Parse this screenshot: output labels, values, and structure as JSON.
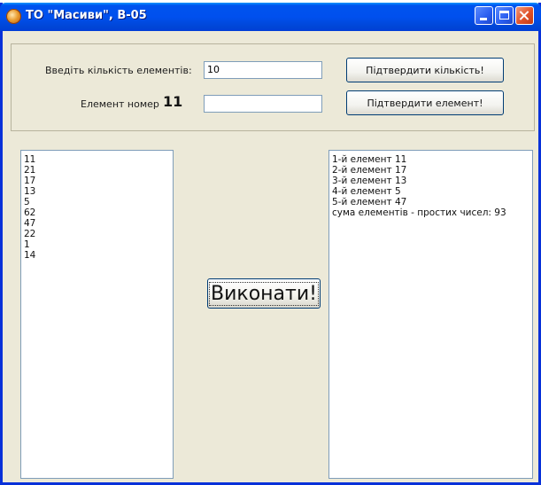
{
  "window": {
    "title": "ТО \"Масиви\", В-05"
  },
  "controls": {
    "count_label": "Введіть кількість елементів:",
    "count_value": "10",
    "confirm_count_label": "Підтвердити кількість!",
    "element_label": "Елемент номер",
    "element_number": "11",
    "element_value": "",
    "confirm_element_label": "Підтвердити елемент!"
  },
  "input_list": {
    "items": [
      "11",
      "21",
      "17",
      "13",
      "5",
      "62",
      "47",
      "22",
      "1",
      "14"
    ]
  },
  "run_button": {
    "label": "Виконати!"
  },
  "output_list": {
    "items": [
      "1-й елемент 11",
      "2-й елемент 17",
      "3-й елемент 13",
      "4-й елемент 5",
      "5-й елемент 47",
      "сума елементів - простих чисел: 93"
    ]
  },
  "icons": {
    "app": "app-icon",
    "minimize": "minimize-icon",
    "maximize": "maximize-icon",
    "close": "close-icon"
  },
  "colors": {
    "titlebar": "#0050ee",
    "window_bg": "#ece9d8",
    "close_button": "#e0522a"
  }
}
